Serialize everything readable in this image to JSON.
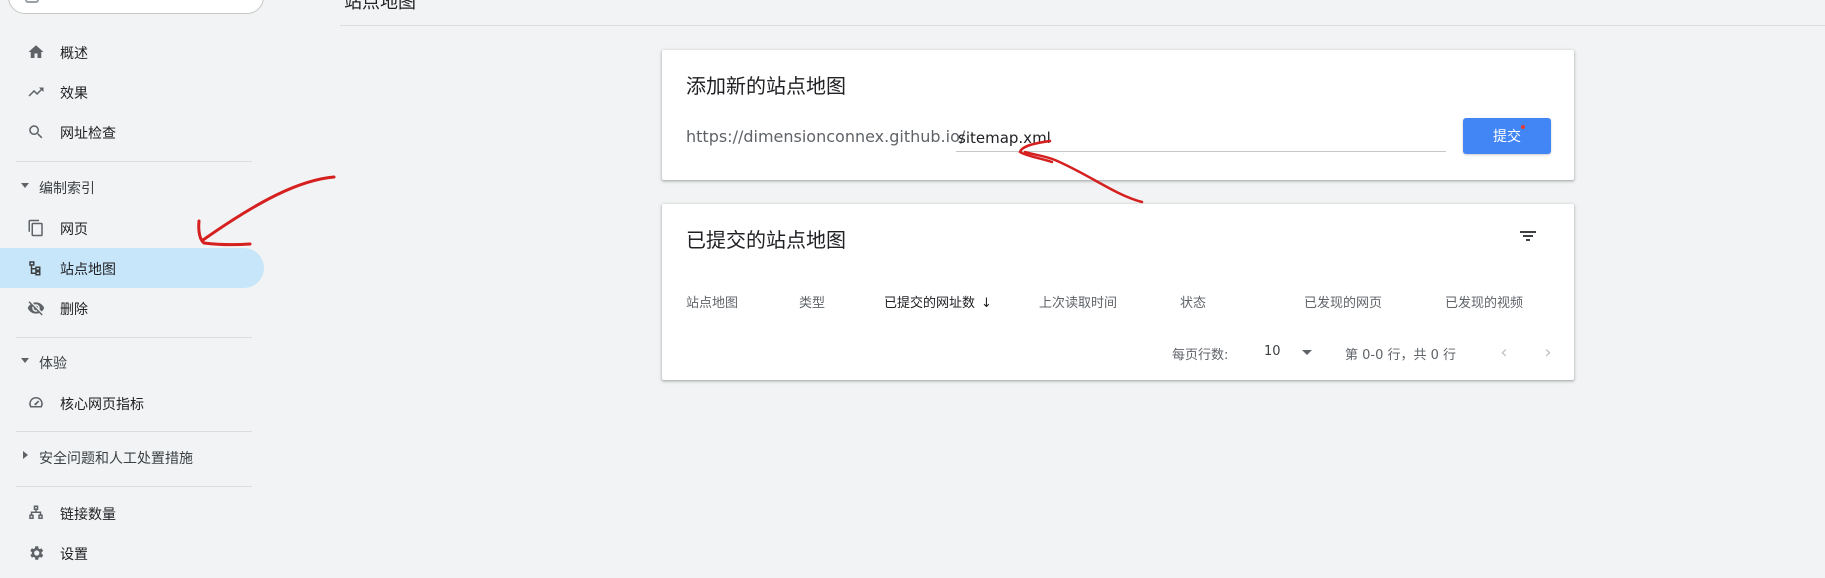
{
  "header": {
    "title": "站点地图"
  },
  "sidebar": {
    "items": [
      {
        "label": "概述"
      },
      {
        "label": "效果"
      },
      {
        "label": "网址检查"
      }
    ],
    "sections": [
      {
        "label": "编制索引"
      },
      {
        "label": "体验"
      },
      {
        "label": "安全问题和人工处置措施"
      }
    ],
    "index_items": [
      {
        "label": "网页"
      },
      {
        "label": "站点地图"
      },
      {
        "label": "删除"
      }
    ],
    "experience_items": [
      {
        "label": "核心网页指标"
      }
    ],
    "bottom_items": [
      {
        "label": "链接数量"
      },
      {
        "label": "设置"
      }
    ]
  },
  "add_card": {
    "title": "添加新的站点地图",
    "url_prefix": "https://dimensionconnex.github.io/",
    "input_value": "sitemap.xml",
    "submit_label": "提交"
  },
  "submitted_card": {
    "title": "已提交的站点地图",
    "columns": [
      "站点地图",
      "类型",
      "已提交的网址数",
      "上次读取时间",
      "状态",
      "已发现的网页",
      "已发现的视频"
    ],
    "sorted_arrow": "↓",
    "pager": {
      "rows_label": "每页行数:",
      "rows_value": "10",
      "range": "第 0-0 行，共 0 行",
      "prev": "‹",
      "next": "›"
    }
  },
  "colors": {
    "accent": "#4285f4",
    "active_nav": "#c8e6fa",
    "annotation": "#d61f1f"
  }
}
